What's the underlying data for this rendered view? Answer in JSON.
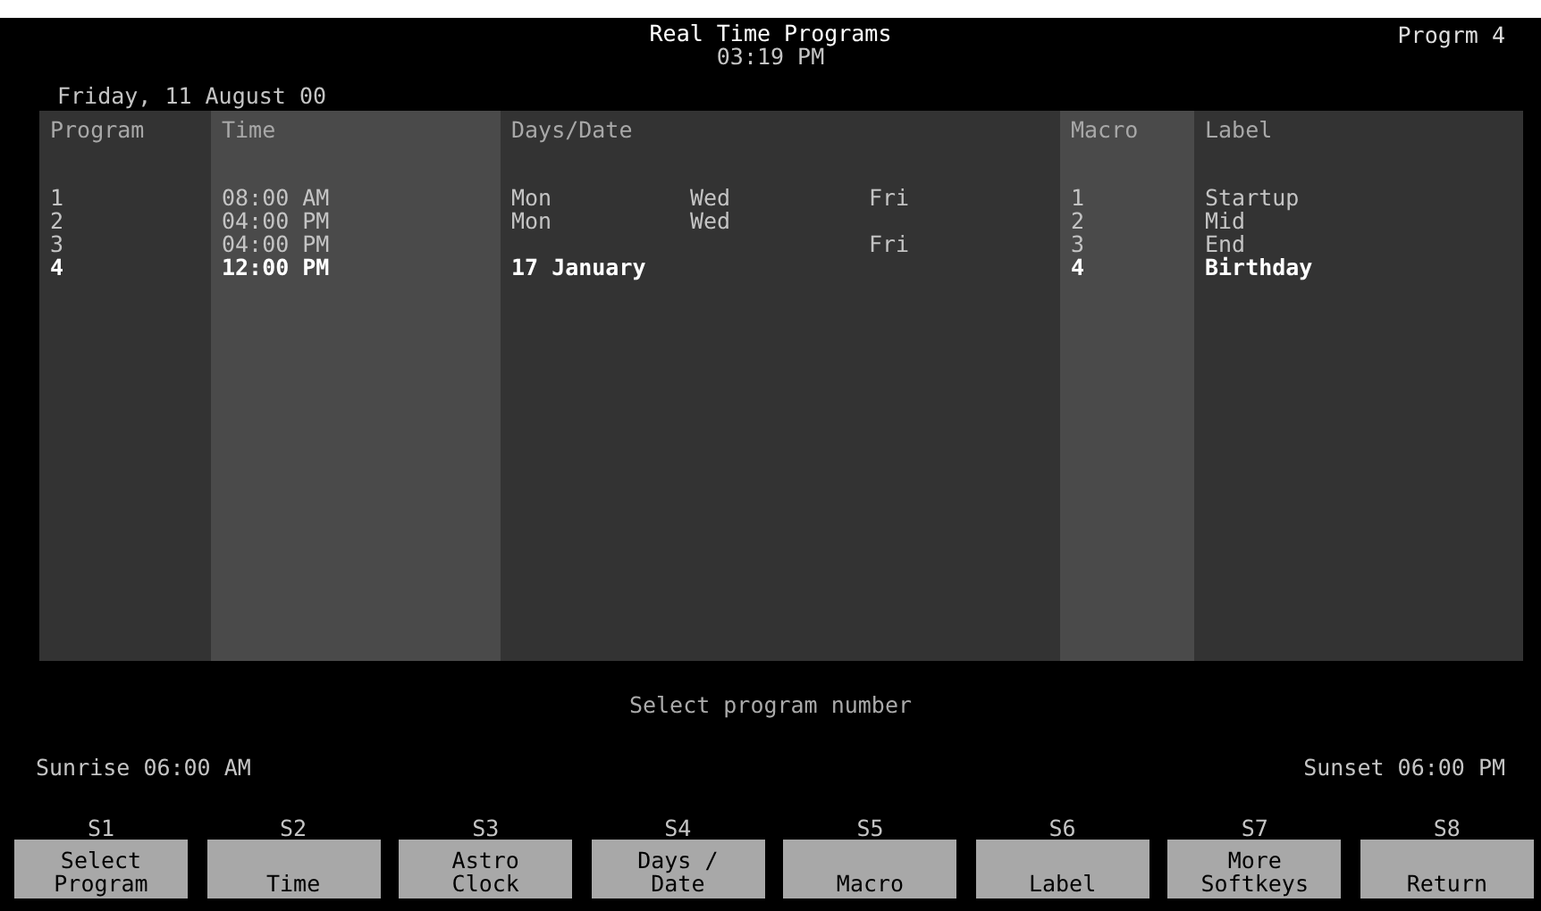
{
  "header": {
    "title": "Real Time Programs",
    "time": "03:19 PM",
    "current": "Progrm 4"
  },
  "date": "Friday, 11 August 00",
  "table": {
    "columns": [
      "Program",
      "Time",
      "Days/Date",
      "Macro",
      "Label"
    ],
    "rows": [
      {
        "program": "1",
        "time": "08:00 AM",
        "kind": "days",
        "day_1": "Mon",
        "day_2": "Wed",
        "day_3": "Fri",
        "macro": "1",
        "label": "Startup",
        "selected": false
      },
      {
        "program": "2",
        "time": "04:00 PM",
        "kind": "days",
        "day_1": "Mon",
        "day_2": "Wed",
        "macro": "2",
        "label": "Mid",
        "selected": false
      },
      {
        "program": "3",
        "time": "04:00 PM",
        "kind": "days",
        "day_3": "Fri",
        "macro": "3",
        "label": "End",
        "selected": false
      },
      {
        "program": "4",
        "time": "12:00 PM",
        "kind": "date",
        "date": "17 January",
        "macro": "4",
        "label": "Birthday",
        "selected": true
      }
    ]
  },
  "prompt": "Select program number",
  "sunrise": "Sunrise 06:00 AM",
  "sunset": "Sunset 06:00 PM",
  "softkeys": [
    {
      "key": "S1",
      "label_lines": [
        "Select",
        "Program"
      ]
    },
    {
      "key": "S2",
      "label_lines": [
        "Time"
      ]
    },
    {
      "key": "S3",
      "label_lines": [
        "Astro",
        "Clock"
      ]
    },
    {
      "key": "S4",
      "label_lines": [
        "Days /",
        "Date"
      ]
    },
    {
      "key": "S5",
      "label_lines": [
        "Macro"
      ]
    },
    {
      "key": "S6",
      "label_lines": [
        "Label"
      ]
    },
    {
      "key": "S7",
      "label_lines": [
        "More",
        "Softkeys"
      ]
    },
    {
      "key": "S8",
      "label_lines": [
        "Return"
      ]
    }
  ]
}
